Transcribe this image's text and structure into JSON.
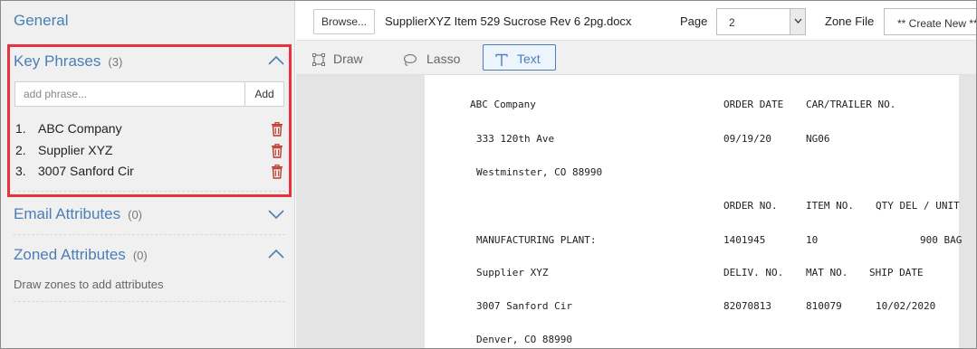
{
  "left_panel": {
    "general": "General",
    "key_phrases": {
      "title": "Key Phrases",
      "count": "(3)",
      "input_placeholder": "add phrase...",
      "add_label": "Add",
      "items": [
        {
          "num": "1.",
          "text": "ABC Company"
        },
        {
          "num": "2.",
          "text": "Supplier XYZ"
        },
        {
          "num": "3.",
          "text": "3007 Sanford Cir"
        }
      ]
    },
    "email_attributes": {
      "title": "Email Attributes",
      "count": "(0)"
    },
    "zoned_attributes": {
      "title": "Zoned Attributes",
      "count": "(0)",
      "hint": "Draw zones to add attributes"
    }
  },
  "toolbar": {
    "browse_label": "Browse...",
    "filename": "SupplierXYZ Item 529 Sucrose Rev 6 2pg.docx",
    "page_label": "Page",
    "page_value": "2",
    "zone_file_label": "Zone File",
    "zone_file_value": "** Create New **"
  },
  "tools": {
    "draw": "Draw",
    "lasso": "Lasso",
    "text": "Text"
  },
  "document": {
    "company": "ABC Company",
    "order_date_hdr": "ORDER DATE",
    "car_trailer_hdr": "CAR/TRAILER NO.",
    "address1": "333 120th Ave",
    "order_date": "09/19/20",
    "car_trailer": "NG06",
    "city1": "Westminster, CO 88990",
    "order_no_hdr": "ORDER NO.",
    "item_no_hdr": "ITEM NO.",
    "qty_hdr": "QTY DEL / UNIT",
    "plant_label": "MANUFACTURING PLANT:",
    "order_no": "1401945",
    "item_no": "10",
    "qty": "900 BAG",
    "supplier": "Supplier XYZ",
    "deliv_hdr": "DELIV. NO.",
    "mat_hdr": "MAT NO.",
    "ship_hdr": "SHIP DATE",
    "address2": "3007 Sanford Cir",
    "deliv_no": "82070813",
    "mat_no": "810079",
    "ship_date": "10/02/2020",
    "city2": "Denver, CO 88990"
  },
  "colors": {
    "accent": "#4a7eb5",
    "highlight_border": "#e8323f",
    "trash": "#c0392b"
  }
}
